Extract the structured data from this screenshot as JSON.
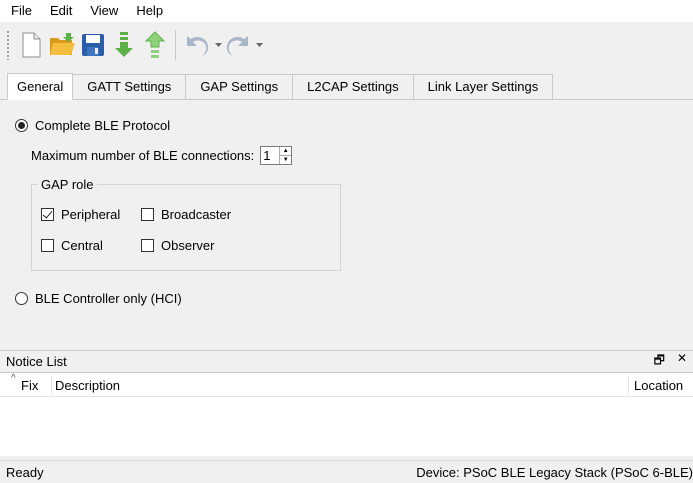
{
  "menu": {
    "items": [
      "File",
      "Edit",
      "View",
      "Help"
    ]
  },
  "toolbar": {
    "buttons": [
      "new-file-icon",
      "open-folder-icon",
      "save-icon",
      "import-icon",
      "export-icon",
      "undo-icon",
      "redo-icon"
    ],
    "colors": {
      "folder": "#f2b233",
      "save": "#2a5ea8",
      "arrow_green": "#5cb246",
      "undo": "#8a9ab0"
    }
  },
  "tabs": [
    "General",
    "GATT Settings",
    "GAP Settings",
    "L2CAP Settings",
    "Link Layer Settings"
  ],
  "general": {
    "complete_protocol_label": "Complete BLE Protocol",
    "max_connections_label": "Maximum number of BLE connections:",
    "max_connections_value": "1",
    "gap_role_title": "GAP role",
    "roles": [
      {
        "label": "Peripheral",
        "checked": true
      },
      {
        "label": "Broadcaster",
        "checked": false
      },
      {
        "label": "Central",
        "checked": false
      },
      {
        "label": "Observer",
        "checked": false
      }
    ],
    "controller_only_label": "BLE Controller only (HCI)"
  },
  "notice_list": {
    "title": "Notice List",
    "float_glyph": "🗗",
    "close_glyph": "✕",
    "columns": {
      "fix": "Fix",
      "description": "Description",
      "location": "Location"
    }
  },
  "status": {
    "left": "Ready",
    "device": "Device: PSoC BLE Legacy Stack (PSoC 6-BLE)"
  }
}
